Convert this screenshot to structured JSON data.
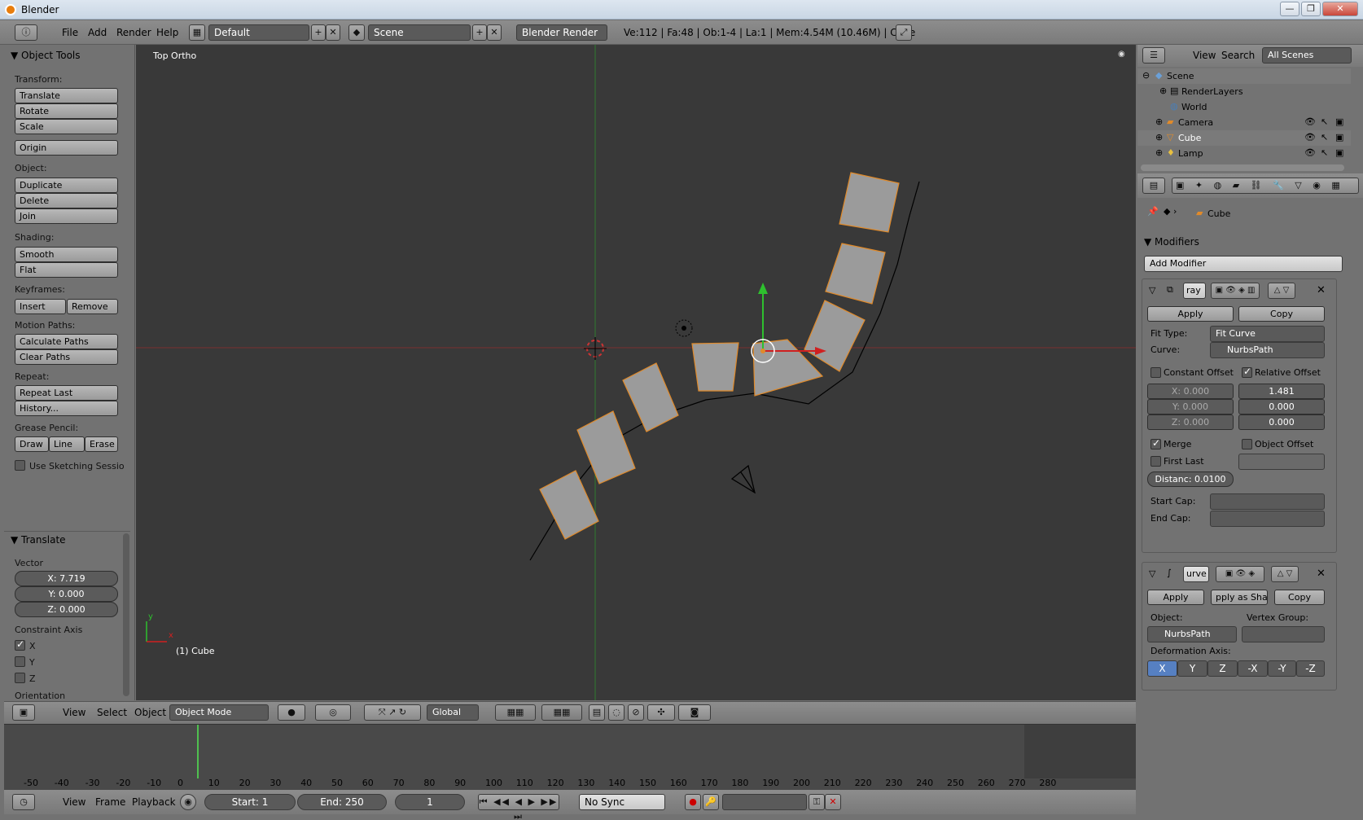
{
  "window": {
    "title": "Blender",
    "min": "—",
    "max": "❐",
    "close": "✕"
  },
  "info": {
    "menus": [
      "File",
      "Add",
      "Render",
      "Help"
    ],
    "layout": "Default",
    "scene": "Scene",
    "engine": "Blender Render",
    "stats": "Ve:112 | Fa:48 | Ob:1-4 | La:1 | Mem:4.54M (10.46M) | Cube"
  },
  "toolshelf": {
    "title": "Object Tools",
    "transform_label": "Transform:",
    "translate": "Translate",
    "rotate": "Rotate",
    "scale": "Scale",
    "origin": "Origin",
    "object_label": "Object:",
    "duplicate": "Duplicate",
    "delete": "Delete",
    "join": "Join",
    "shading_label": "Shading:",
    "smooth": "Smooth",
    "flat": "Flat",
    "keyframes_label": "Keyframes:",
    "insert": "Insert",
    "remove": "Remove",
    "motion_label": "Motion Paths:",
    "calc_paths": "Calculate Paths",
    "clear_paths": "Clear Paths",
    "repeat_label": "Repeat:",
    "repeat_last": "Repeat Last",
    "history": "History...",
    "grease_label": "Grease Pencil:",
    "draw": "Draw",
    "line": "Line",
    "erase": "Erase",
    "sketching": "Use Sketching Sessio"
  },
  "operator": {
    "title": "Translate",
    "vector_label": "Vector",
    "x": "X: 7.719",
    "y": "Y: 0.000",
    "z": "Z: 0.000",
    "constraint_label": "Constraint Axis",
    "cx": "X",
    "cy": "Y",
    "cz": "Z",
    "orientation_label": "Orientation"
  },
  "viewport": {
    "view_name": "Top Ortho",
    "object_label": "(1) Cube",
    "axis_y": "y",
    "axis_x": "x"
  },
  "v3dheader": {
    "menus": [
      "View",
      "Select",
      "Object"
    ],
    "mode": "Object Mode",
    "orientation": "Global"
  },
  "timeline": {
    "ticks": [
      "-50",
      "-40",
      "-30",
      "-20",
      "-10",
      "0",
      "10",
      "20",
      "30",
      "40",
      "50",
      "60",
      "70",
      "80",
      "90",
      "100",
      "110",
      "120",
      "130",
      "140",
      "150",
      "160",
      "170",
      "180",
      "190",
      "200",
      "210",
      "220",
      "230",
      "240",
      "250",
      "260",
      "270",
      "280"
    ],
    "menus": [
      "View",
      "Frame",
      "Playback"
    ],
    "start": "Start: 1",
    "end": "End: 250",
    "current": "1",
    "sync": "No Sync"
  },
  "outliner": {
    "view": "View",
    "search": "Search",
    "filter": "All Scenes",
    "items": [
      "Scene",
      "RenderLayers",
      "World",
      "Camera",
      "Cube",
      "Lamp"
    ]
  },
  "properties": {
    "context": "Cube",
    "modifiers_title": "Modifiers",
    "add_modifier": "Add Modifier",
    "array": {
      "name": "ray",
      "apply": "Apply",
      "copy": "Copy",
      "fit_type_label": "Fit Type:",
      "fit_type": "Fit Curve",
      "curve_label": "Curve:",
      "curve": "NurbsPath",
      "constant_offset": "Constant Offset",
      "relative_offset": "Relative Offset",
      "cx": "X: 0.000",
      "cy": "Y: 0.000",
      "cz": "Z: 0.000",
      "rx": "1.481",
      "ry": "0.000",
      "rz": "0.000",
      "merge": "Merge",
      "object_offset": "Object Offset",
      "first_last": "First Last",
      "distance": "Distanc: 0.0100",
      "start_cap": "Start Cap:",
      "end_cap": "End Cap:"
    },
    "curve_mod": {
      "name": "urve",
      "apply": "Apply",
      "apply_shape": "pply as Shap",
      "copy": "Copy",
      "object_label": "Object:",
      "vgroup_label": "Vertex Group:",
      "object": "NurbsPath",
      "deform_label": "Deformation Axis:",
      "axes": [
        "X",
        "Y",
        "Z",
        "-X",
        "-Y",
        "-Z"
      ]
    }
  }
}
